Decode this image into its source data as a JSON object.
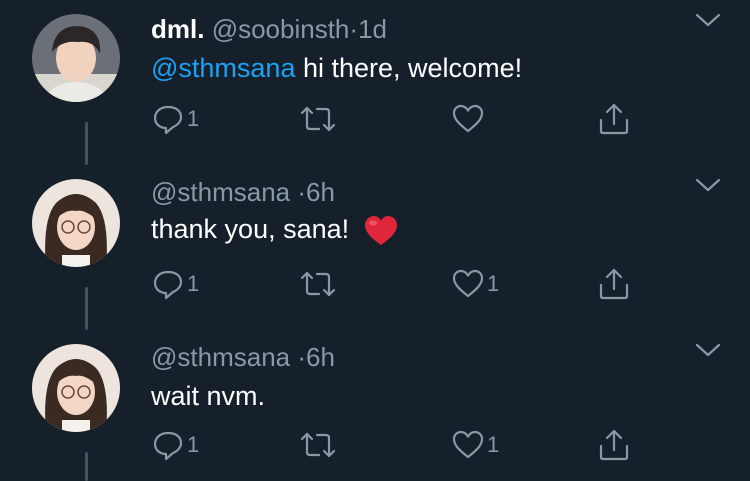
{
  "colors": {
    "background": "#15202b",
    "text_primary": "#ffffff",
    "text_secondary": "#8899a6",
    "mention": "#1da1f2",
    "heart_emoji": "#e0263b",
    "thread_line": "#3d5466"
  },
  "tweets": [
    {
      "display_name": "dml.",
      "handle": "@soobinsth",
      "separator": "·",
      "time": "1d",
      "mention": "@sthmsana",
      "text": "hi there, welcome!",
      "reply_count": "1",
      "retweet_count": "",
      "like_count": "",
      "avatar": "avatar-male",
      "emoji": ""
    },
    {
      "display_name": "",
      "handle": "@sthmsana",
      "separator": "·",
      "time": "6h",
      "mention": "",
      "text": "thank you, sana!",
      "reply_count": "1",
      "retweet_count": "",
      "like_count": "1",
      "avatar": "avatar-female",
      "emoji": "red-heart-emoji"
    },
    {
      "display_name": "",
      "handle": "@sthmsana",
      "separator": "·",
      "time": "6h",
      "mention": "",
      "text": "wait nvm.",
      "reply_count": "1",
      "retweet_count": "",
      "like_count": "1",
      "avatar": "avatar-female",
      "emoji": ""
    }
  ],
  "icons": {
    "reply": "reply-icon",
    "retweet": "retweet-icon",
    "like": "heart-icon",
    "share": "share-icon",
    "menu": "chevron-down-icon"
  }
}
